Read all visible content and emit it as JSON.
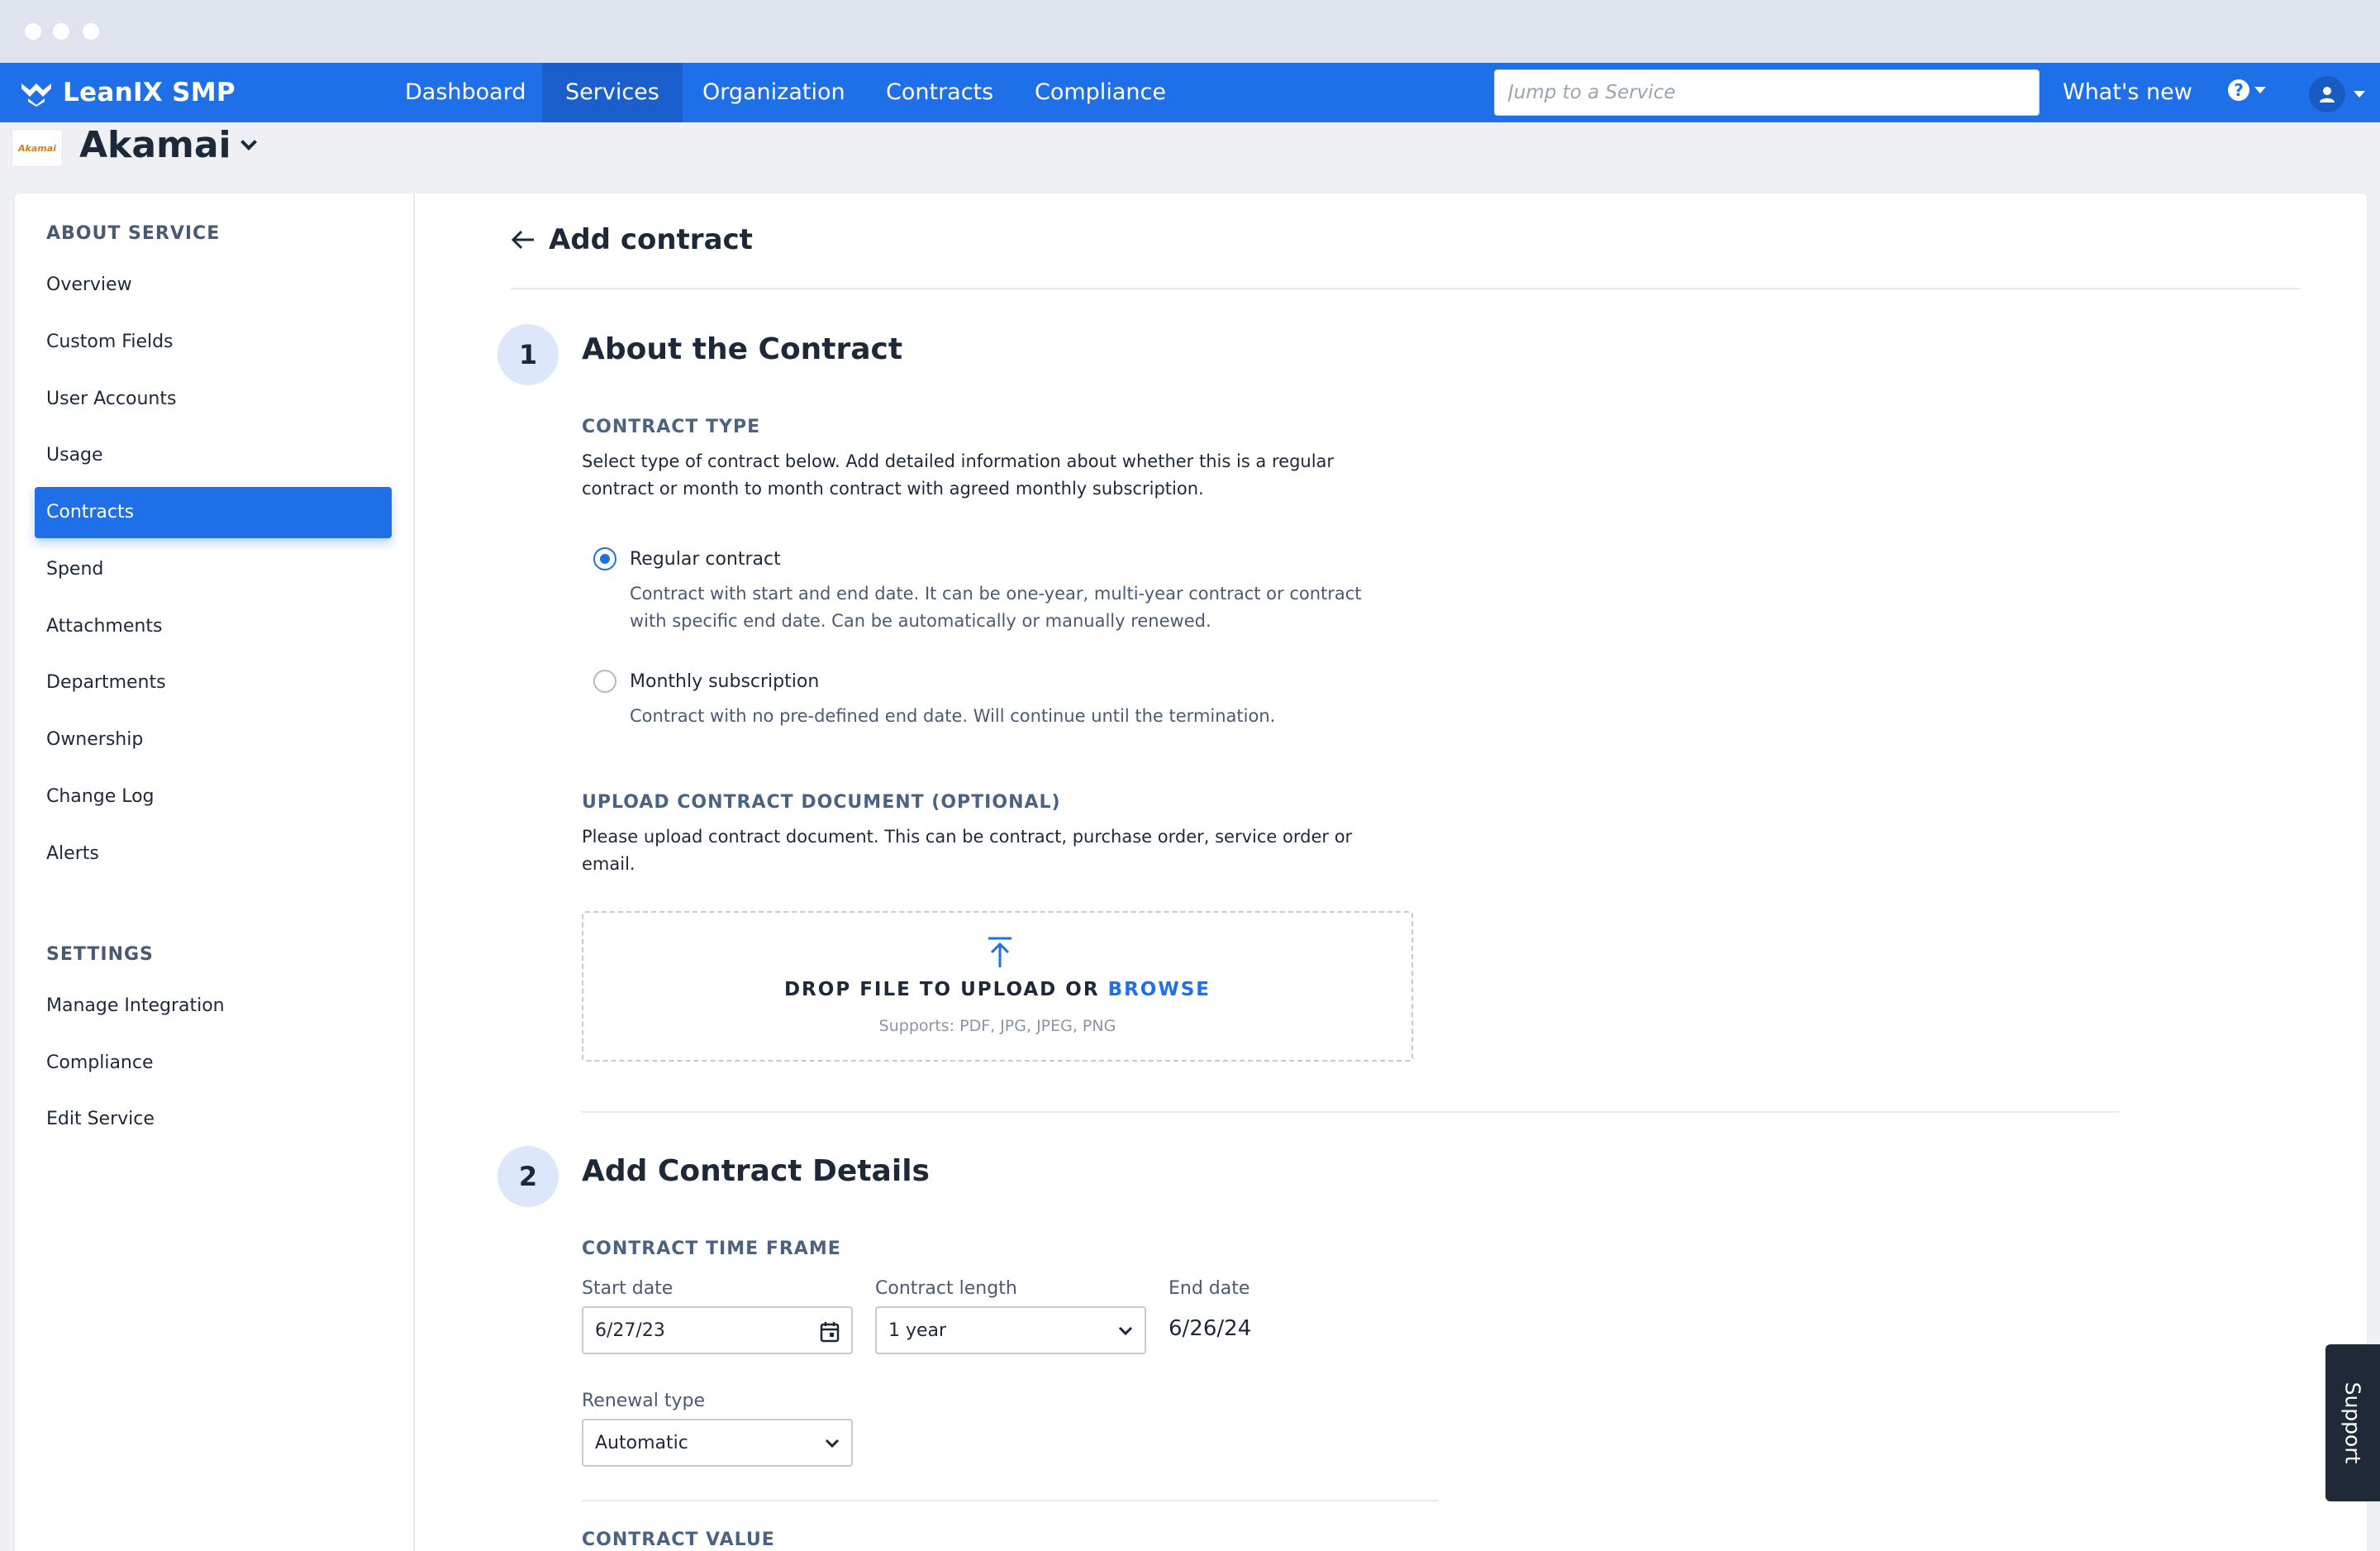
{
  "brand": {
    "name": "LeanIX SMP"
  },
  "nav": {
    "items": [
      {
        "label": "Dashboard"
      },
      {
        "label": "Services"
      },
      {
        "label": "Organization"
      },
      {
        "label": "Contracts"
      },
      {
        "label": "Compliance"
      }
    ],
    "active": "Services",
    "search_placeholder": "Jump to a Service",
    "whats_new": "What's new"
  },
  "service": {
    "name": "Akamai",
    "logo_text": "Akamai"
  },
  "sidebar": {
    "about_heading": "ABOUT SERVICE",
    "about_items": [
      {
        "label": "Overview"
      },
      {
        "label": "Custom Fields"
      },
      {
        "label": "User Accounts"
      },
      {
        "label": "Usage"
      },
      {
        "label": "Contracts"
      },
      {
        "label": "Spend"
      },
      {
        "label": "Attachments"
      },
      {
        "label": "Departments"
      },
      {
        "label": "Ownership"
      },
      {
        "label": "Change Log"
      },
      {
        "label": "Alerts"
      }
    ],
    "active": "Contracts",
    "settings_heading": "SETTINGS",
    "settings_items": [
      {
        "label": "Manage Integration"
      },
      {
        "label": "Compliance"
      },
      {
        "label": "Edit Service"
      }
    ]
  },
  "page": {
    "title": "Add contract",
    "step1": {
      "number": "1",
      "title": "About the Contract",
      "contract_type_label": "CONTRACT TYPE",
      "contract_type_desc": "Select type of contract below. Add detailed information about whether this is a regular contract or month to month contract with agreed monthly subscription.",
      "options": [
        {
          "label": "Regular contract",
          "desc": "Contract with start and end date. It can be one-year, multi-year contract or contract with specific end date. Can be automatically or manually renewed.",
          "checked": true
        },
        {
          "label": "Monthly subscription",
          "desc": "Contract with no pre-defined end date. Will continue until the termination.",
          "checked": false
        }
      ],
      "upload_label": "UPLOAD CONTRACT DOCUMENT (OPTIONAL)",
      "upload_desc": "Please upload contract document. This can be contract, purchase order, service order or email.",
      "dropzone_text": "DROP FILE TO UPLOAD OR",
      "dropzone_browse": "BROWSE",
      "dropzone_supports": "Supports: PDF, JPG, JPEG, PNG"
    },
    "step2": {
      "number": "2",
      "title": "Add Contract Details",
      "timeframe_label": "CONTRACT TIME FRAME",
      "start_date_label": "Start date",
      "start_date_value": "6/27/23",
      "length_label": "Contract length",
      "length_value": "1 year",
      "end_date_label": "End date",
      "end_date_value": "6/26/24",
      "renewal_label": "Renewal type",
      "renewal_value": "Automatic",
      "value_label": "CONTRACT VALUE"
    }
  },
  "support": {
    "label": "Support"
  },
  "colors": {
    "primary": "#1f6fe8",
    "nav_active": "#1a5fcc",
    "sidebar_active": "#1f6fe8"
  }
}
